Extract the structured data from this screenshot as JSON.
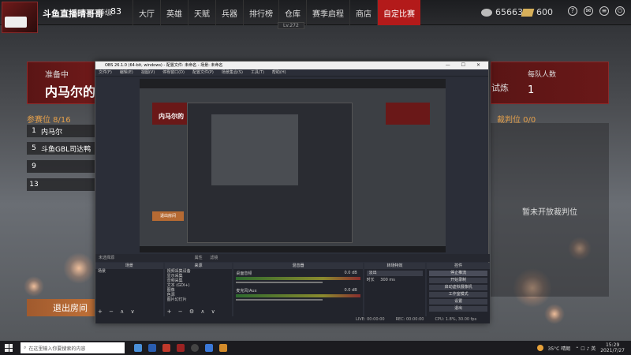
{
  "topbar": {
    "player_name": "斗鱼直播晴哥哥",
    "level_label": "等级",
    "level_value": "83",
    "nav": [
      "大厅",
      "英雄",
      "天赋",
      "兵器",
      "排行榜",
      "仓库",
      "赛季启程",
      "商店",
      "自定比赛"
    ],
    "active_nav": "自定比赛",
    "version": "Lv.272",
    "silver": "65663",
    "gold": "600"
  },
  "room": {
    "status_label": "准备中",
    "status_title": "内马尔的",
    "mode_text": "试炼",
    "team_size_label": "每队人数",
    "team_size_value": "1",
    "participants_title": "参赛位 8/16",
    "referee_title": "裁判位 0/0",
    "referee_empty": "暂未开放裁判位",
    "slots": [
      {
        "num": "1",
        "name": "内马尔"
      },
      {
        "num": "5",
        "name": "斗鱼GBL司达鸭"
      },
      {
        "num": "9",
        "name": ""
      },
      {
        "num": "13",
        "name": ""
      }
    ],
    "exit_label": "退出房间"
  },
  "obs": {
    "title": "OBS 26.1.0 (64-bit, windows) - 配置文件: 未命名 - 场景: 未命名",
    "menu": [
      "文件(F)",
      "编辑(E)",
      "视图(V)",
      "停靠窗口(D)",
      "配置文件(P)",
      "场景集合(S)",
      "工具(T)",
      "帮助(H)"
    ],
    "no_source": "未选择源",
    "props_label": "属性",
    "filters_label": "滤镜",
    "docks": {
      "scenes_title": "场景",
      "scenes": [
        "场景"
      ],
      "sources_title": "来源",
      "sources": [
        "视频采集设备",
        "显示采集",
        "音频采集",
        "文本 (GDI+)",
        "图像",
        "色源",
        "图片幻灯片"
      ],
      "mixer_title": "混音器",
      "mixer": [
        {
          "name": "桌面音频",
          "level": "0.0 dB"
        },
        {
          "name": "麦克风/Aux",
          "level": "0.0 dB"
        }
      ],
      "transitions_title": "转场特效",
      "transition_type": "淡出",
      "duration_label": "时长",
      "duration_value": "300 ms",
      "controls_title": "控件",
      "controls": [
        "停止推流",
        "开始录制",
        "启动虚拟摄像机",
        "工作室模式",
        "设置",
        "退出"
      ]
    },
    "status": {
      "live": "LIVE: 00:00:00",
      "rec": "REC: 00:00:00",
      "cpu": "CPU: 1.8%, 30.00 fps"
    }
  },
  "taskbar": {
    "search_placeholder": "在这里输入你要搜索的内容",
    "weather": "35°C 晴朗",
    "time": "15:29",
    "date": "2021/7/27"
  },
  "colors": {
    "accent_red": "#b31a1a",
    "participant_title": "#e6a04a",
    "exit_button": "#c8773a"
  }
}
